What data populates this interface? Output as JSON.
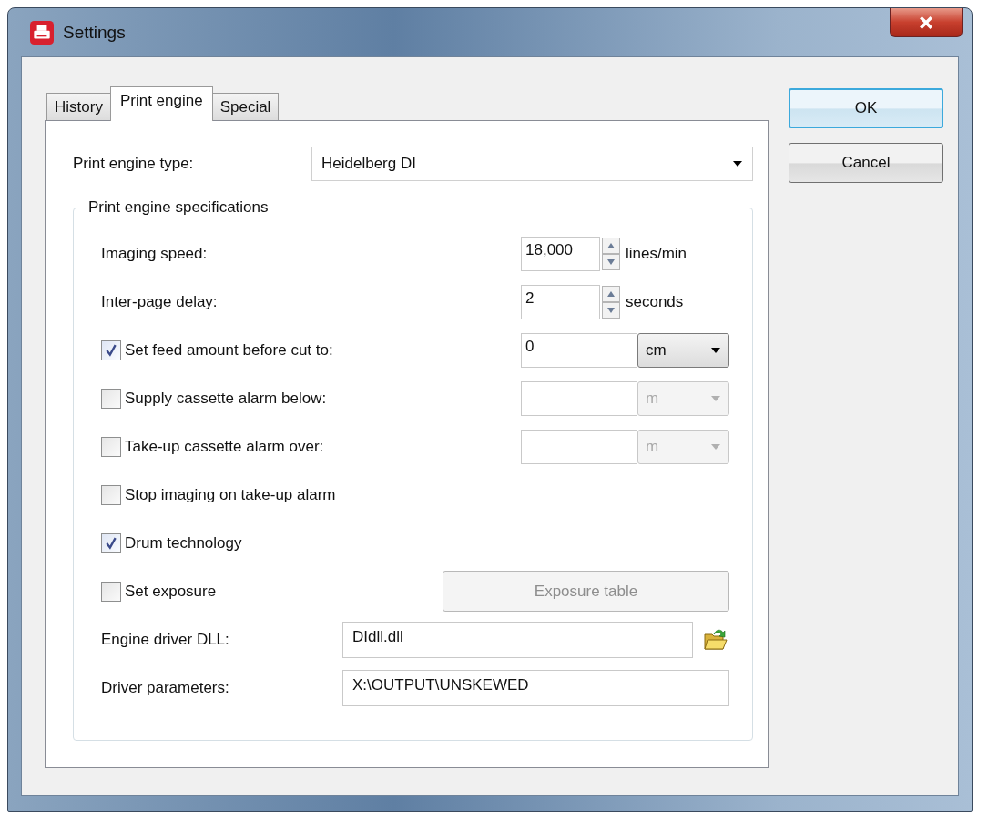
{
  "window": {
    "title": "Settings"
  },
  "tabs": [
    {
      "label": "History",
      "selected": false
    },
    {
      "label": "Print engine",
      "selected": true
    },
    {
      "label": "Special",
      "selected": false
    }
  ],
  "engine_type": {
    "label": "Print engine type:",
    "value": "Heidelberg DI"
  },
  "group": {
    "title": "Print engine specifications",
    "rows": [
      {
        "kind": "spin",
        "label": "Imaging speed:",
        "value": "18,000",
        "unit": "lines/min"
      },
      {
        "kind": "spin",
        "label": "Inter-page delay:",
        "value": "2",
        "unit": "seconds"
      },
      {
        "kind": "check_input",
        "label": "Set feed amount before cut to:",
        "checked": true,
        "value": "0",
        "unit": "cm",
        "disabled": false
      },
      {
        "kind": "check_input",
        "label": "Supply cassette alarm below:",
        "checked": false,
        "unit": "m",
        "disabled": true
      },
      {
        "kind": "check_input",
        "label": "Take-up cassette alarm over:",
        "checked": false,
        "unit": "m",
        "disabled": true
      },
      {
        "kind": "check",
        "label": "Stop imaging on take-up alarm",
        "checked": false
      },
      {
        "kind": "check",
        "label": "Drum technology",
        "checked": true
      },
      {
        "kind": "check_button",
        "label": "Set exposure",
        "checked": false,
        "button": "Exposure table",
        "disabled": true
      },
      {
        "kind": "file",
        "label": "Engine driver DLL:",
        "value": "DIdll.dll"
      },
      {
        "kind": "text",
        "label": "Driver parameters:",
        "value": "X:\\OUTPUT\\UNSKEWED"
      }
    ]
  },
  "buttons": [
    {
      "label": "OK",
      "default": true
    },
    {
      "label": "Cancel",
      "default": false
    }
  ]
}
